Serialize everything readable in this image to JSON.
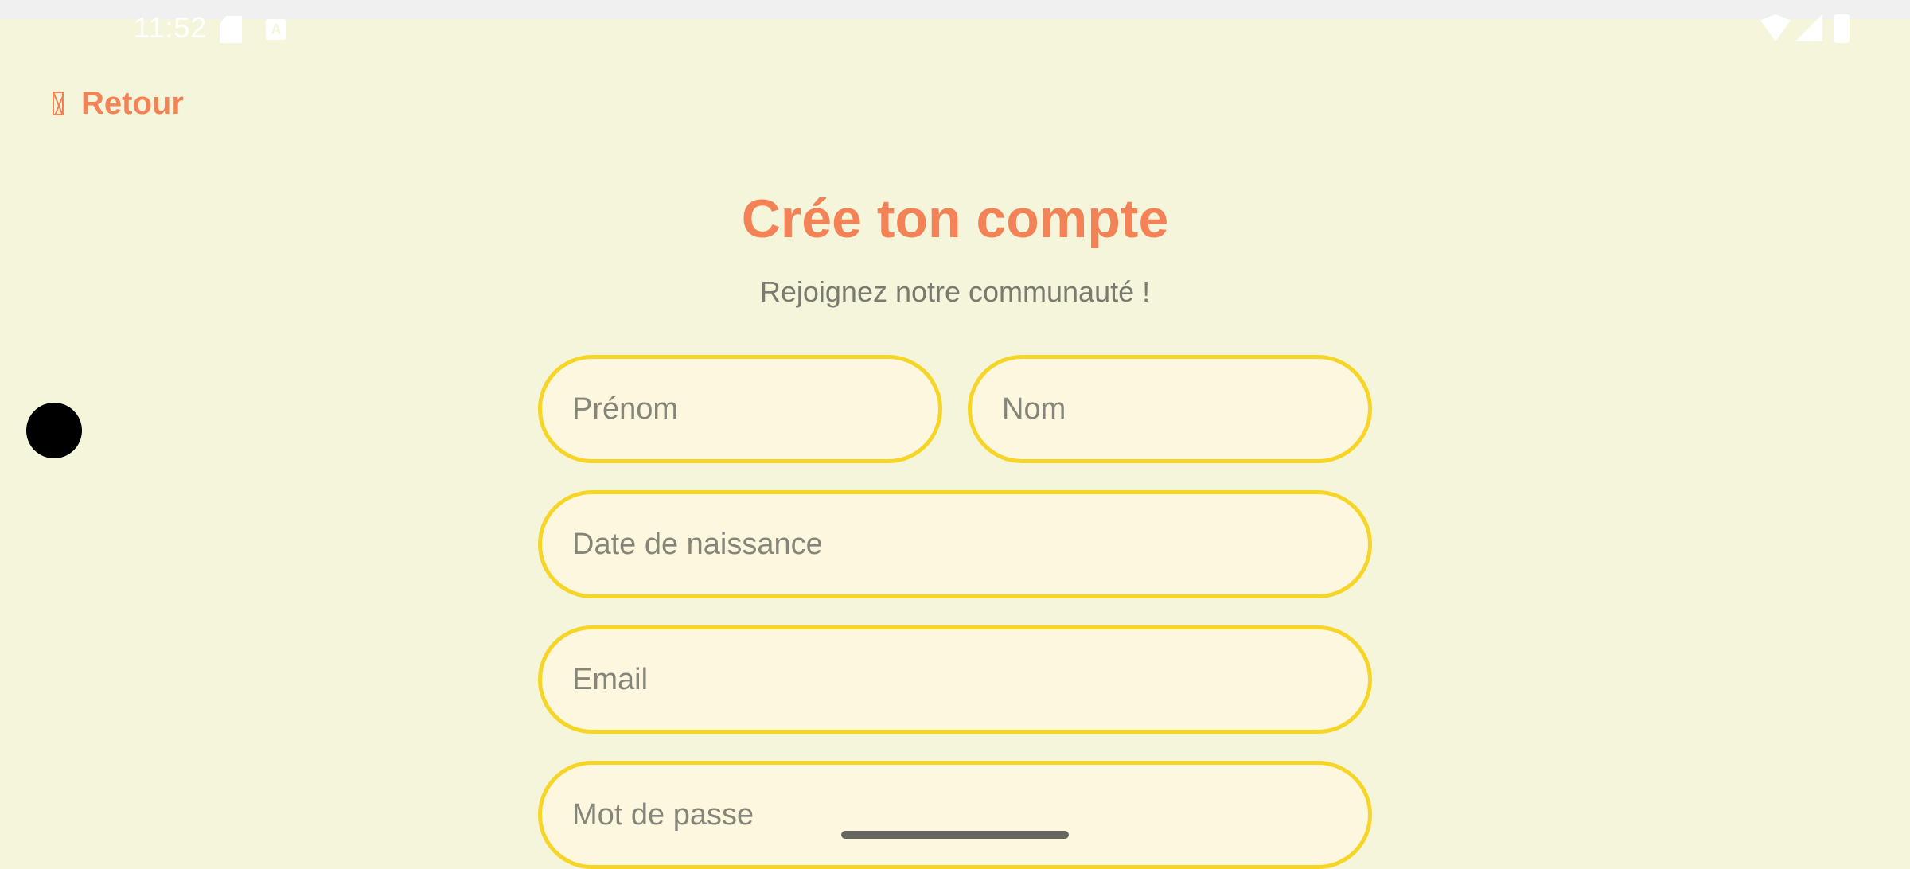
{
  "status_bar": {
    "time": "11:52",
    "icons": [
      "sd-card-icon",
      "a-keyboard-icon",
      "wifi-icon",
      "signal-icon",
      "battery-icon"
    ]
  },
  "header": {
    "back_label": "Retour",
    "back_icon": "back-arrow-icon"
  },
  "main": {
    "title": "Crée ton compte",
    "subtitle": "Rejoignez notre communauté !"
  },
  "form": {
    "first_name": {
      "placeholder": "Prénom",
      "value": ""
    },
    "last_name": {
      "placeholder": "Nom",
      "value": ""
    },
    "birth_date": {
      "placeholder": "Date de naissance",
      "value": ""
    },
    "email": {
      "placeholder": "Email",
      "value": ""
    },
    "password": {
      "placeholder": "Mot de passe",
      "value": ""
    }
  },
  "colors": {
    "background": "#f5f5dc",
    "accent": "#f38357",
    "field_border": "#f6d526",
    "field_fill": "#fdf7df",
    "muted_text": "#7a7a70"
  }
}
